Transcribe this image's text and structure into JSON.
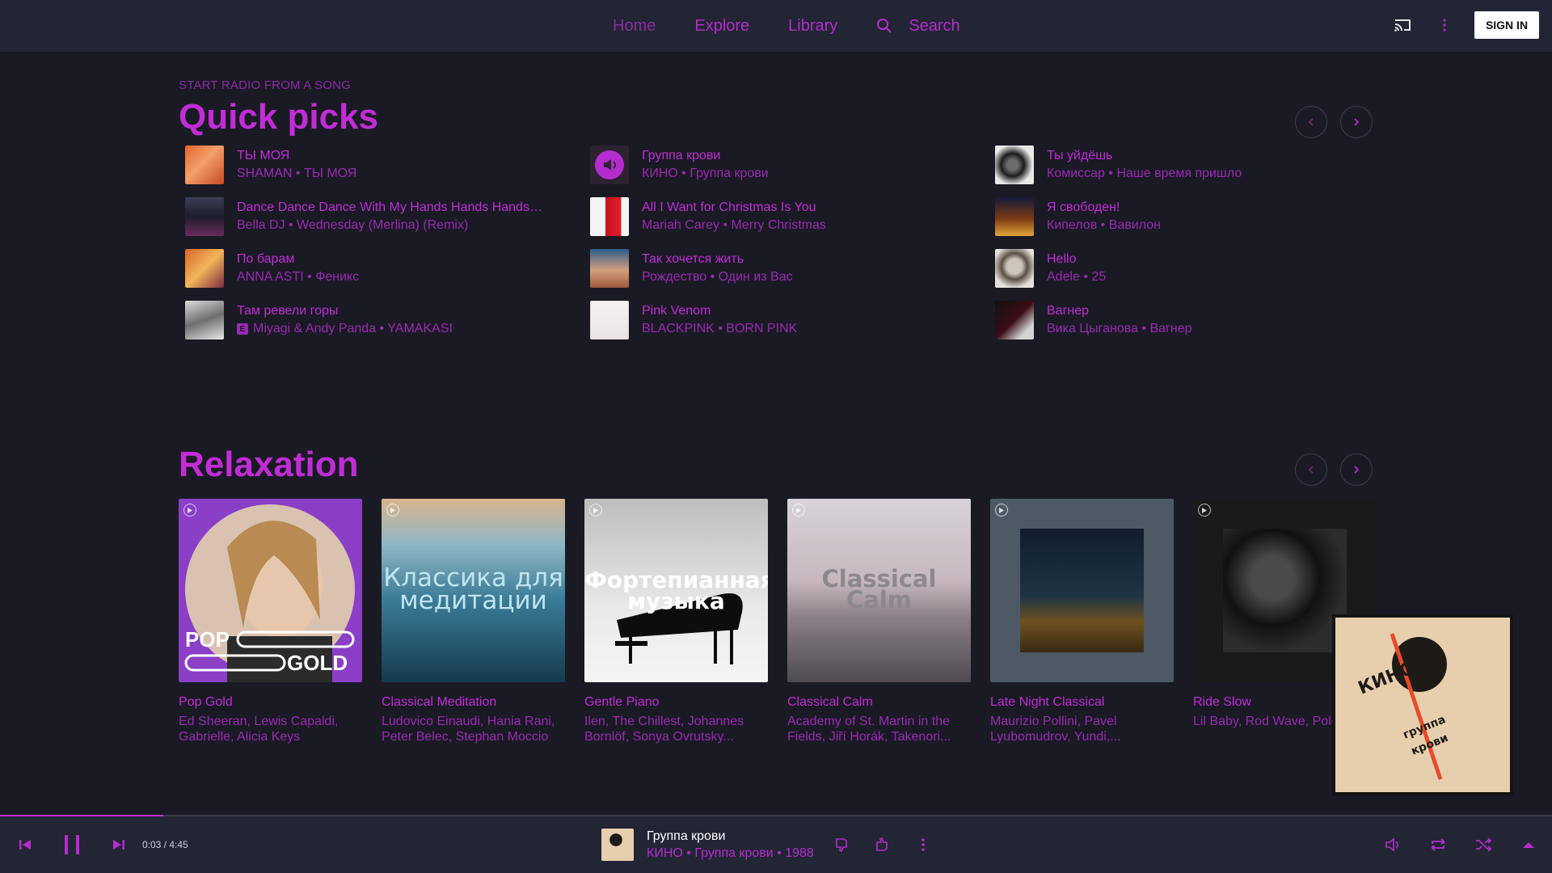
{
  "colors": {
    "accent": "#c22cd6",
    "accent_dim": "#9b29b3",
    "background": "#191a24",
    "bar": "#222534"
  },
  "nav": {
    "home": "Home",
    "explore": "Explore",
    "library": "Library",
    "search": "Search",
    "sign_in": "SIGN IN"
  },
  "quick_picks": {
    "eyebrow": "START RADIO FROM A SONG",
    "title": "Quick picks",
    "items": [
      {
        "title": "ТЫ МОЯ",
        "subtitle": "SHAMAN • ТЫ МОЯ"
      },
      {
        "title": "Группа крови",
        "subtitle": "КИНО • Группа крови"
      },
      {
        "title": "Ты уйдёшь",
        "subtitle": "Комиссар • Наше время пришло"
      },
      {
        "title": "Dance Dance Dance With My Hands Hands Hands (...",
        "subtitle": "Bella DJ • Wednesday (Merlina) (Remix)"
      },
      {
        "title": "All I Want for Christmas Is You",
        "subtitle": "Mariah Carey • Merry Christmas"
      },
      {
        "title": "Я свободен!",
        "subtitle": "Кипелов • Вавилон"
      },
      {
        "title": "По барам",
        "subtitle": "ANNA ASTI • Феникс"
      },
      {
        "title": "Так хочется жить",
        "subtitle": "Рождество • Один из Вас"
      },
      {
        "title": "Hello",
        "subtitle": "Adele • 25"
      },
      {
        "title": "Там ревели горы",
        "subtitle": "Miyagi & Andy Panda • YAMAKASI",
        "explicit": "E"
      },
      {
        "title": "Pink Venom",
        "subtitle": "BLACKPINK • BORN PINK"
      },
      {
        "title": "Вагнер",
        "subtitle": "Вика Цыганова • Вагнер"
      }
    ]
  },
  "relaxation": {
    "title": "Relaxation",
    "cards": [
      {
        "title": "Pop Gold",
        "subtitle": "Ed Sheeran, Lewis Capaldi, Gabrielle, Alicia Keys",
        "art_text_1": "POP",
        "art_text_2": "GOLD"
      },
      {
        "title": "Classical Meditation",
        "subtitle": "Ludovico Einaudi, Hania Rani, Peter Belec, Stephan Moccio",
        "art_text_1": "Классика для",
        "art_text_2": "медитации"
      },
      {
        "title": "Gentle Piano",
        "subtitle": "Ilen, The Chillest, Johannes Bornlöf, Sonya Ovrutsky...",
        "art_text_1": "Фортепианная",
        "art_text_2": "музыка"
      },
      {
        "title": "Classical Calm",
        "subtitle": "Academy of St. Martin in the Fields, Jiří Horák, Takenori...",
        "art_text_1": "Classical",
        "art_text_2": "Calm"
      },
      {
        "title": "Late Night Classical",
        "subtitle": "Maurizio Pollini, Pavel Lyubomudrov, Yundi,..."
      },
      {
        "title": "Ride Slow",
        "subtitle": "Lil Baby, Rod Wave, Polo Cole"
      }
    ]
  },
  "mini_art": {
    "text_1": "КИНО",
    "text_2": "группа",
    "text_3": "крови"
  },
  "player": {
    "time": "0:03 / 4:45",
    "progress": 0.105,
    "track_title": "Группа крови",
    "track_subtitle": "КИНО • Группа крови • 1988"
  }
}
